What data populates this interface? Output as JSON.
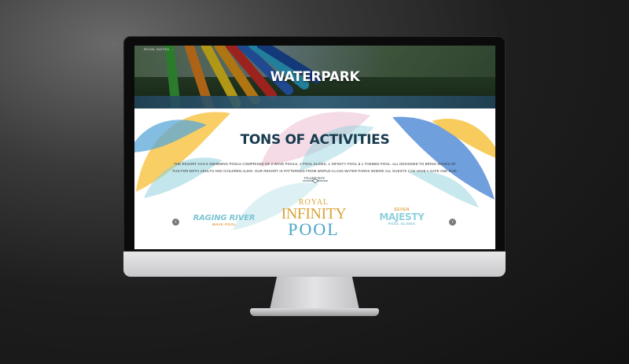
{
  "hero": {
    "nav_text": "ROYAL SUITES ...",
    "title": "WATERPARK"
  },
  "activities": {
    "title": "TONS OF ACTIVITIES",
    "description": "THE RESORT HAS 9 SWIMMING POOLS COMPRISED OF 2 WAVE POOLS, 2 POOL SLIDES, 1 INFINITY POOL & 1 THEMED POOL. ALL DESIGNED TO BRING WAVES OF FUN FOR BOTH ADULTS AND CHILDREN ALIKE. OUR RESORT IS PATTERNED FROM WORLD-CLASS WATER PARKS WHERE ALL GUESTS CAN HAVE A SAFE AND FUN-FILLED DAY."
  },
  "carousel": {
    "prev_icon": "chevron-left-icon",
    "next_icon": "chevron-right-icon",
    "prev_glyph": "‹",
    "next_glyph": "›",
    "logos": [
      {
        "line1": "RAGING RIVER",
        "line2": "WAVE POOL"
      },
      {
        "line1": "ROYAL",
        "line2": "INFINITY",
        "line3": "POOL"
      },
      {
        "line1": "SEVEN",
        "line2": "MAJESTY",
        "line3": "POOL SLIDES"
      }
    ]
  },
  "colors": {
    "title": "#173b4e",
    "accent_yellow": "#f7c64a",
    "accent_blue": "#4aa6c9",
    "accent_gold": "#d9a53b"
  }
}
